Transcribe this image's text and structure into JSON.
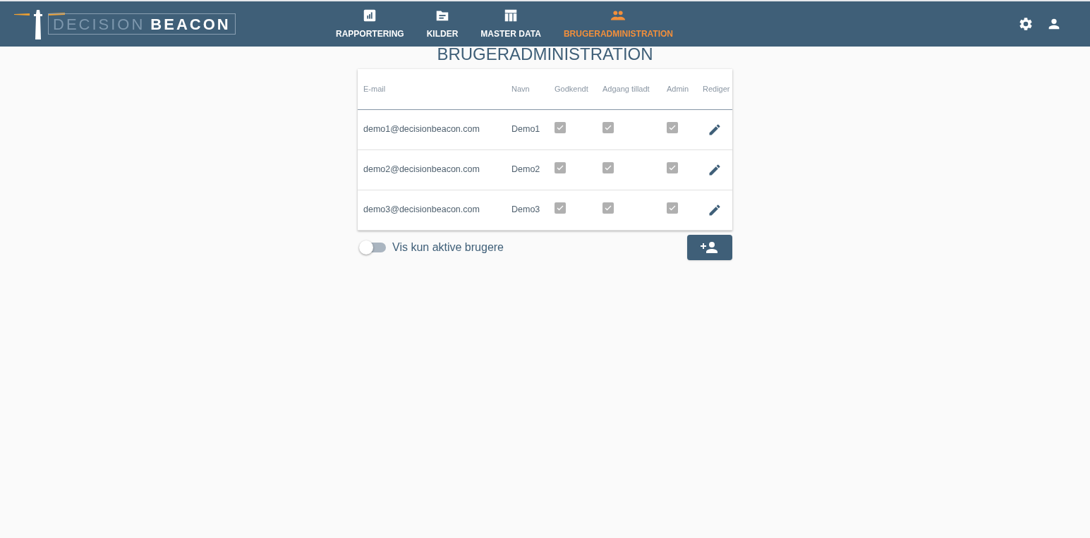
{
  "logo": {
    "word_1": "DECISION",
    "word_2": "BEACON"
  },
  "nav": [
    {
      "label": "RAPPORTERING",
      "selected": false
    },
    {
      "label": "KILDER",
      "selected": false
    },
    {
      "label": "MASTER DATA",
      "selected": false
    },
    {
      "label": "BRUGERADMINISTRATION",
      "selected": true
    }
  ],
  "page_title": "BRUGERADMINISTRATION",
  "table": {
    "columns": [
      "E-mail",
      "Navn",
      "Godkendt",
      "Adgang tilladt",
      "Admin",
      "Rediger"
    ],
    "rows": [
      {
        "email": "demo1@decisionbeacon.com",
        "name": "Demo1",
        "approved": true,
        "access": true,
        "admin": true
      },
      {
        "email": "demo2@decisionbeacon.com",
        "name": "Demo2",
        "approved": true,
        "access": true,
        "admin": true
      },
      {
        "email": "demo3@decisionbeacon.com",
        "name": "Demo3",
        "approved": true,
        "access": true,
        "admin": true
      }
    ]
  },
  "active_toggle": {
    "label": "Vis kun aktive brugere",
    "on": false
  }
}
